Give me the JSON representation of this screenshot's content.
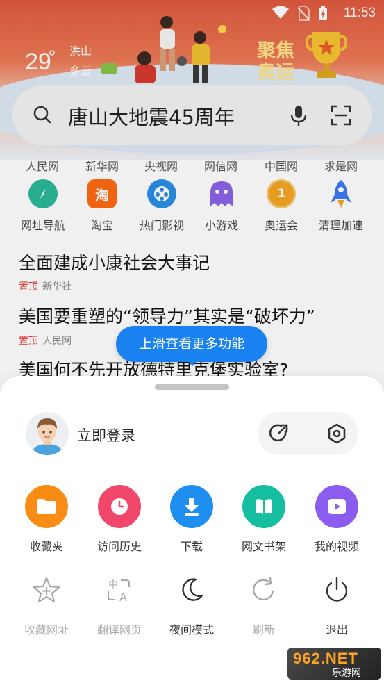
{
  "status_bar": {
    "time": "11:53",
    "icons": [
      "wifi-icon",
      "no-sim-icon",
      "battery-charging-icon"
    ]
  },
  "weather": {
    "temperature": "29",
    "city": "洪山",
    "condition": "多云"
  },
  "banner": {
    "title": "聚焦奥运"
  },
  "search": {
    "query": "唐山大地震45周年"
  },
  "quick_links": [
    "人民网",
    "新华网",
    "央视网",
    "网信网",
    "中国网",
    "求是网"
  ],
  "apps": [
    {
      "label": "网址导航",
      "icon": "compass-icon",
      "color": "#2bb89a"
    },
    {
      "label": "淘宝",
      "icon": "taobao-icon",
      "color": "#ff6a13",
      "glyph": "淘"
    },
    {
      "label": "热门影视",
      "icon": "film-reel-icon",
      "color": "#2b8fe8"
    },
    {
      "label": "小游戏",
      "icon": "ghost-icon",
      "color": "#8b63e8"
    },
    {
      "label": "奥运会",
      "icon": "medal-icon",
      "color": "#f5a623",
      "glyph": "1"
    },
    {
      "label": "清理加速",
      "icon": "rocket-icon",
      "color": "#3d7cf5"
    }
  ],
  "news": [
    {
      "title": "全面建成小康社会大事记",
      "pin": "置顶",
      "source": "新华社"
    },
    {
      "title": "美国要重塑的“领导力”其实是“破坏力”",
      "pin": "置顶",
      "source": "人民网"
    },
    {
      "title": "美国何不先开放德特里克堡实验室?"
    }
  ],
  "tooltip": "上滑查看更多功能",
  "sheet": {
    "login": "立即登录",
    "menu": [
      {
        "label": "收藏夹",
        "icon": "folder-icon",
        "color": "#f98c14"
      },
      {
        "label": "访问历史",
        "icon": "clock-icon",
        "color": "#f0476b"
      },
      {
        "label": "下载",
        "icon": "download-icon",
        "color": "#1e8ff0"
      },
      {
        "label": "网文书架",
        "icon": "book-icon",
        "color": "#16bea0"
      },
      {
        "label": "我的视频",
        "icon": "video-play-icon",
        "color": "#8c5cf0"
      }
    ],
    "tools": [
      {
        "label": "收藏网址",
        "icon": "star-plus-icon",
        "disabled": true
      },
      {
        "label": "翻译网页",
        "icon": "translate-icon",
        "disabled": true
      },
      {
        "label": "夜间模式",
        "icon": "moon-icon",
        "disabled": false
      },
      {
        "label": "刷新",
        "icon": "refresh-icon",
        "disabled": true
      },
      {
        "label": "退出",
        "icon": "power-icon",
        "disabled": false
      }
    ]
  },
  "watermark": {
    "main": "962.NET",
    "sub": "乐游网"
  }
}
